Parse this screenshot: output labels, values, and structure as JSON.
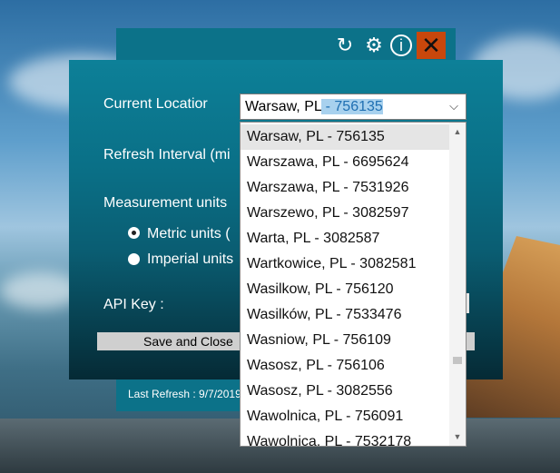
{
  "toolbar": {
    "refresh_icon": "refresh-icon",
    "settings_icon": "gear-icon",
    "info_icon": "info-icon",
    "close_icon": "close-icon"
  },
  "settings": {
    "current_location_label": "Current Locatior",
    "refresh_interval_label": "Refresh Interval (mi",
    "measurement_units_label": "Measurement units",
    "metric_label": "Metric units (",
    "imperial_label": "Imperial units",
    "api_key_label": "API Key :",
    "save_button": "Save and Close",
    "last_refresh": "Last Refresh : 9/7/2019"
  },
  "location_combo": {
    "value_prefix": "Warsaw, PL",
    "value_selected": " - 756135"
  },
  "dropdown": {
    "items": [
      "Warsaw, PL - 756135",
      "Warszawa, PL - 6695624",
      "Warszawa, PL - 7531926",
      "Warszewo, PL - 3082597",
      "Warta, PL - 3082587",
      "Wartkowice, PL - 3082581",
      "Wasilkow, PL - 756120",
      "Wasilków, PL - 7533476",
      "Wasniow, PL - 756109",
      "Wasosz, PL - 756106",
      "Wasosz, PL - 3082556",
      "Wawolnica, PL - 756091",
      "Wawolnica, PL - 7532178"
    ]
  },
  "colors": {
    "panel": "#0a6f86",
    "close_button": "#c8470c",
    "selection": "#a8d1ee"
  }
}
